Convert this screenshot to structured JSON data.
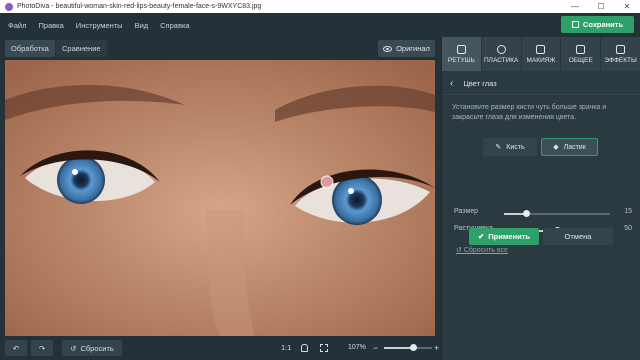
{
  "window": {
    "title": "PhotoDiva - beautiful-woman-skin-red-lips-beauty-female-face-s-9WXYC83.jpg",
    "minimize": "—",
    "maximize": "☐",
    "close": "✕"
  },
  "menu": [
    "Файл",
    "Правка",
    "Инструменты",
    "Вид",
    "Справка"
  ],
  "save_label": "Сохранить",
  "view_tabs": {
    "process": "Обработка",
    "compare": "Сравнение"
  },
  "original_label": "Оригинал",
  "tools": [
    {
      "label": "РЕТУШЬ",
      "icon": "retouch-icon"
    },
    {
      "label": "ПЛАСТИКА",
      "icon": "plastic-icon"
    },
    {
      "label": "МАКИЯЖ",
      "icon": "makeup-icon"
    },
    {
      "label": "ОБЩЕЕ",
      "icon": "sliders-icon"
    },
    {
      "label": "ЭФФЕКТЫ",
      "icon": "effects-icon"
    }
  ],
  "section_title": "Цвет глаз",
  "hint": "Установите размер кисти чуть больше зрачка и закрасьте глаза для изменения цвета.",
  "brush_label": "Кисть",
  "eraser_label": "Ластик",
  "sliders": {
    "size": {
      "label": "Размер",
      "value": "15",
      "fraction": 0.21
    },
    "feather": {
      "label": "Растушевка",
      "value": "50",
      "fraction": 0.5
    }
  },
  "reset_all": "Сбросить все",
  "apply_label": "Применить",
  "cancel_label": "Отмена",
  "bottom": {
    "reset_label": "Сбросить",
    "ratio": "1:1",
    "zoom": "107%",
    "zoom_fraction": 0.6
  },
  "colors": {
    "accent": "#2ea06a",
    "panel": "#2b3941",
    "iris": "#4a86c0"
  }
}
